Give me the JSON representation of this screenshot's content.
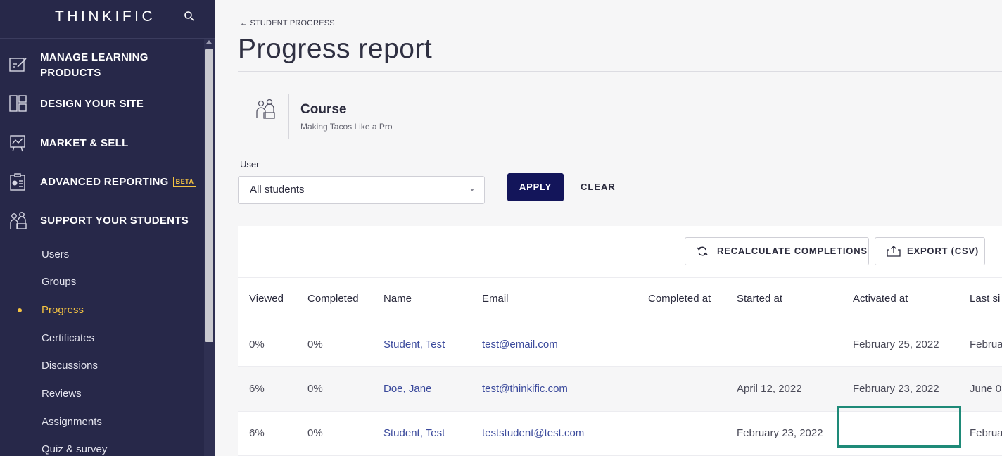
{
  "sidebar": {
    "logo": "THINKIFIC",
    "nav": [
      {
        "label_line1": "MANAGE LEARNING",
        "label_line2": "PRODUCTS",
        "icon": "edit-icon"
      },
      {
        "label": "DESIGN YOUR SITE",
        "icon": "layout-icon"
      },
      {
        "label": "MARKET & SELL",
        "icon": "chart-icon"
      },
      {
        "label": "ADVANCED REPORTING",
        "badge": "BETA",
        "icon": "report-icon"
      },
      {
        "label": "SUPPORT YOUR STUDENTS",
        "icon": "students-icon"
      }
    ],
    "sub_items": [
      "Users",
      "Groups",
      "Progress",
      "Certificates",
      "Discussions",
      "Reviews",
      "Assignments",
      "Quiz & survey"
    ],
    "active_sub_item": "Progress",
    "accent_color": "#f5c342",
    "background_color": "#272849"
  },
  "header": {
    "breadcrumb": "← STUDENT PROGRESS",
    "title": "Progress report"
  },
  "course": {
    "type": "Course",
    "name": "Making Tacos Like a Pro"
  },
  "filter": {
    "label": "User",
    "selected": "All students",
    "apply_label": "APPLY",
    "clear_label": "CLEAR"
  },
  "toolbar": {
    "recalculate_label": "RECALCULATE COMPLETIONS",
    "export_label": "EXPORT (CSV)"
  },
  "table": {
    "columns": [
      "Viewed",
      "Completed",
      "Name",
      "Email",
      "Completed at",
      "Started at",
      "Activated at",
      "Last si"
    ],
    "rows": [
      {
        "viewed": "0%",
        "completed": "0%",
        "name": "Student, Test",
        "email": "test@email.com",
        "completed_at": "",
        "started_at": "",
        "activated_at": "February 25, 2022",
        "last_signed_in": "Februa"
      },
      {
        "viewed": "6%",
        "completed": "0%",
        "name": "Doe, Jane",
        "email": "test@thinkific.com",
        "completed_at": "",
        "started_at": "April 12, 2022",
        "activated_at": "February 23, 2022",
        "last_signed_in": "June 0."
      },
      {
        "viewed": "6%",
        "completed": "0%",
        "name": "Student, Test",
        "email": "teststudent@test.com",
        "completed_at": "",
        "started_at": "February 23, 2022",
        "activated_at": "",
        "last_signed_in": "Februa"
      }
    ]
  },
  "colors": {
    "primary_button": "#13155a",
    "link": "#3b4a9c",
    "highlight": "#1e8a78"
  }
}
